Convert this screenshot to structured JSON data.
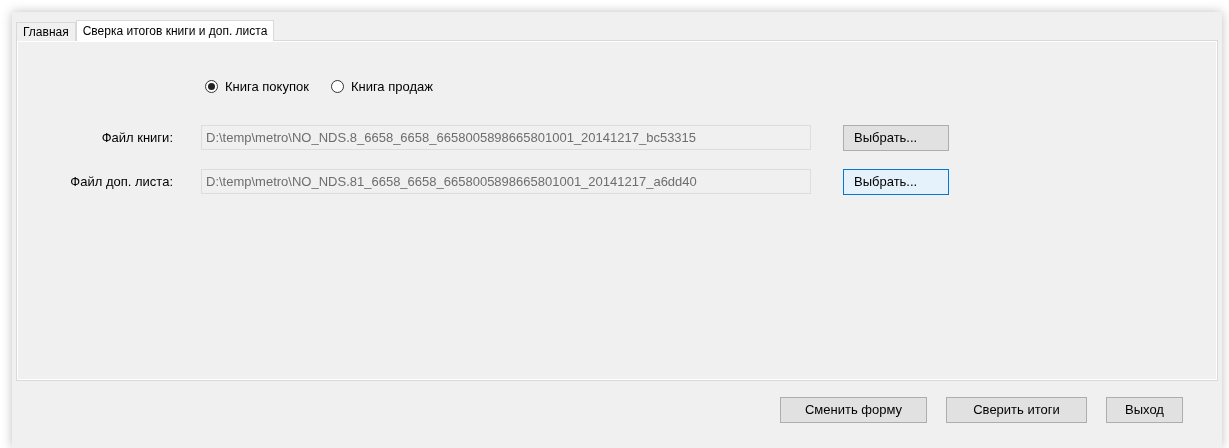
{
  "tabs": [
    {
      "label": "Главная",
      "selected": false
    },
    {
      "label": "Сверка итогов книги и доп. листа",
      "selected": true
    }
  ],
  "book_type": [
    {
      "label": "Книга покупок",
      "selected": true
    },
    {
      "label": "Книга продаж",
      "selected": false
    }
  ],
  "file_rows": [
    {
      "label": "Файл книги:",
      "value": "D:\\temp\\metro\\NO_NDS.8_6658_6658_6658005898665801001_20141217_bc53315",
      "button": {
        "label": "Выбрать...",
        "focused": false
      }
    },
    {
      "label": "Файл доп. листа:",
      "value": "D:\\temp\\metro\\NO_NDS.81_6658_6658_6658005898665801001_20141217_a6dd40",
      "button": {
        "label": "Выбрать...",
        "focused": true
      }
    }
  ],
  "buttons": [
    {
      "label": "Сменить форму"
    },
    {
      "label": "Сверить итоги"
    },
    {
      "label": "Выход"
    }
  ]
}
